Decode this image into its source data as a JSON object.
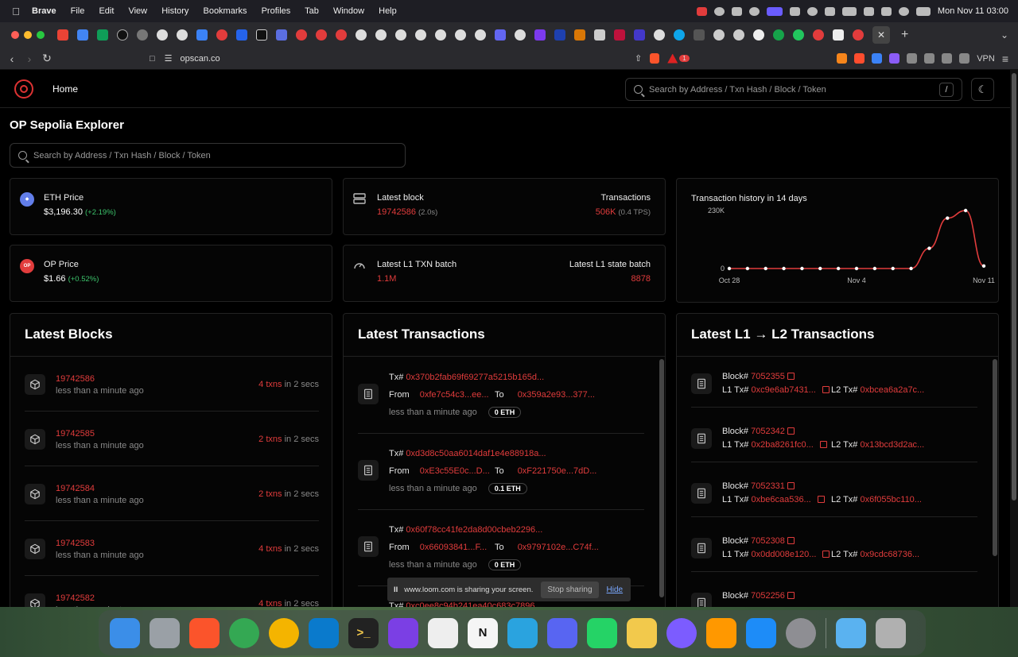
{
  "menubar": {
    "app": "Brave",
    "items": [
      "File",
      "Edit",
      "View",
      "History",
      "Bookmarks",
      "Profiles",
      "Tab",
      "Window",
      "Help"
    ],
    "datetime": "Mon Nov 11  03:00"
  },
  "browser": {
    "url": "opscan.co",
    "vpn_label": "VPN",
    "brave_badge": "1"
  },
  "site": {
    "nav_home": "Home",
    "search_placeholder": "Search by Address / Txn Hash / Block / Token",
    "search_shortcut": "/",
    "title": "OP Sepolia Explorer"
  },
  "stats": {
    "eth_price_label": "ETH Price",
    "eth_price": "$3,196.30",
    "eth_change": "(+2.19%)",
    "op_price_label": "OP Price",
    "op_price": "$1.66",
    "op_change": "(+0.52%)",
    "op_coin_text": "OP",
    "latest_block_label": "Latest block",
    "latest_block": "19742586",
    "latest_block_time": "(2.0s)",
    "transactions_label": "Transactions",
    "transactions": "506K",
    "tps": "(0.4 TPS)",
    "l1_batch_label": "Latest L1 TXN batch",
    "l1_batch": "1.1M",
    "l1_state_label": "Latest L1 state batch",
    "l1_state": "8878"
  },
  "chart_data": {
    "type": "line",
    "title": "Transaction history in 14 days",
    "x": [
      "Oct 28",
      "Oct 29",
      "Oct 30",
      "Oct 31",
      "Nov 1",
      "Nov 2",
      "Nov 3",
      "Nov 4",
      "Nov 5",
      "Nov 6",
      "Nov 7",
      "Nov 8",
      "Nov 9",
      "Nov 10",
      "Nov 11"
    ],
    "values": [
      0,
      0,
      0,
      0,
      0,
      0,
      0,
      0,
      0,
      0,
      0,
      80000,
      200000,
      230000,
      10000
    ],
    "x_tick_labels": [
      "Oct 28",
      "Nov 4",
      "Nov 11"
    ],
    "y_tick_labels": [
      "0",
      "230K"
    ],
    "ylim": [
      0,
      230000
    ],
    "color": "#e13c3c"
  },
  "blocks": {
    "title": "Latest Blocks",
    "items": [
      {
        "number": "19742586",
        "age": "less than a minute ago",
        "txns": "4 txns",
        "in": "in 2 secs"
      },
      {
        "number": "19742585",
        "age": "less than a minute ago",
        "txns": "2 txns",
        "in": "in 2 secs"
      },
      {
        "number": "19742584",
        "age": "less than a minute ago",
        "txns": "2 txns",
        "in": "in 2 secs"
      },
      {
        "number": "19742583",
        "age": "less than a minute ago",
        "txns": "4 txns",
        "in": "in 2 secs"
      },
      {
        "number": "19742582",
        "age": "less than a minute ago",
        "txns": "4 txns",
        "in": "in 2 secs"
      }
    ]
  },
  "transactions": {
    "title": "Latest Transactions",
    "tx_label": "Tx#",
    "from_label": "From",
    "to_label": "To",
    "items": [
      {
        "hash": "0x370b2fab69f69277a5215b165d...",
        "from": "0xfe7c54c3...ee...",
        "to": "0x359a2e93...377...",
        "age": "less than a minute ago",
        "value": "0 ETH"
      },
      {
        "hash": "0xd3d8c50aa6014daf1e4e88918a...",
        "from": "0xE3c55E0c...D...",
        "to": "0xF221750e...7dD...",
        "age": "less than a minute ago",
        "value": "0.1 ETH"
      },
      {
        "hash": "0x60f78cc41fe2da8d00cbeb2296...",
        "from": "0x66093841...F...",
        "to": "0x9797102e...C74f...",
        "age": "less than a minute ago",
        "value": "0 ETH"
      },
      {
        "hash": "0xc0ee8c94b241ea40c683c7896...",
        "from": "",
        "to": "",
        "age": "",
        "value": ""
      }
    ]
  },
  "l1l2": {
    "title": "Latest L1 → L2 Transactions",
    "block_label": "Block#",
    "l1_label": "L1 Tx#",
    "l2_label": "L2 Tx#",
    "items": [
      {
        "block": "7052355",
        "l1": "0xc9e6ab7431...",
        "l2": "0xbcea6a2a7c..."
      },
      {
        "block": "7052342",
        "l1": "0x2ba8261fc0...",
        "l2": "0x13bcd3d2ac..."
      },
      {
        "block": "7052331",
        "l1": "0xbe6caa536...",
        "l2": "0x6f055bc110..."
      },
      {
        "block": "7052308",
        "l1": "0x0dd008e120...",
        "l2": "0x9cdc68736..."
      },
      {
        "block": "7052256",
        "l1": "",
        "l2": ""
      }
    ]
  },
  "loom": {
    "pause": "II",
    "text": "www.loom.com is sharing your screen.",
    "stop": "Stop sharing",
    "hide": "Hide"
  },
  "dock": {
    "apps": [
      "finder-icon",
      "launchpad-icon",
      "brave-icon",
      "chrome-icon",
      "chrome-canary-icon",
      "vscode-icon",
      "terminal-icon",
      "github-desktop-icon",
      "slack-icon",
      "notion-icon",
      "telegram-icon",
      "discord-icon",
      "whatsapp-icon",
      "cyberduck-icon",
      "arc-icon",
      "sublime-icon",
      "app-store-icon",
      "settings-icon",
      "folder-icon",
      "trash-icon"
    ],
    "notion_glyph": "N",
    "terminal_glyph": ">_"
  }
}
